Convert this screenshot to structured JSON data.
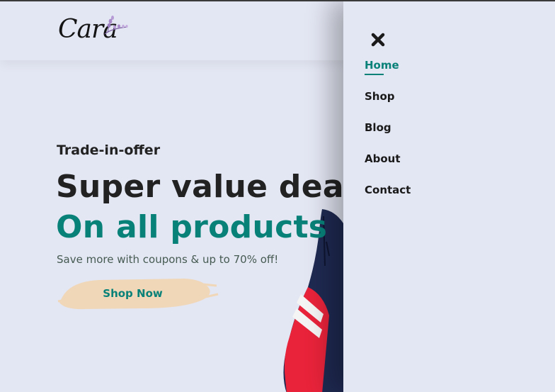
{
  "brand": {
    "logo_text": "Cara"
  },
  "hero": {
    "eyebrow": "Trade-in-offer",
    "title": "Super value deals",
    "subtitle": "On all products",
    "description": "Save more with coupons & up to 70% off!",
    "cta_label": "Shop Now"
  },
  "drawer": {
    "close_icon": "close-icon",
    "items": [
      {
        "label": "Home",
        "active": true
      },
      {
        "label": "Shop",
        "active": false
      },
      {
        "label": "Blog",
        "active": false
      },
      {
        "label": "About",
        "active": false
      },
      {
        "label": "Contact",
        "active": false
      }
    ]
  },
  "colors": {
    "accent": "#088178",
    "background": "#e3e6f3",
    "button_brush": "#f0d7b8",
    "text": "#222222"
  }
}
